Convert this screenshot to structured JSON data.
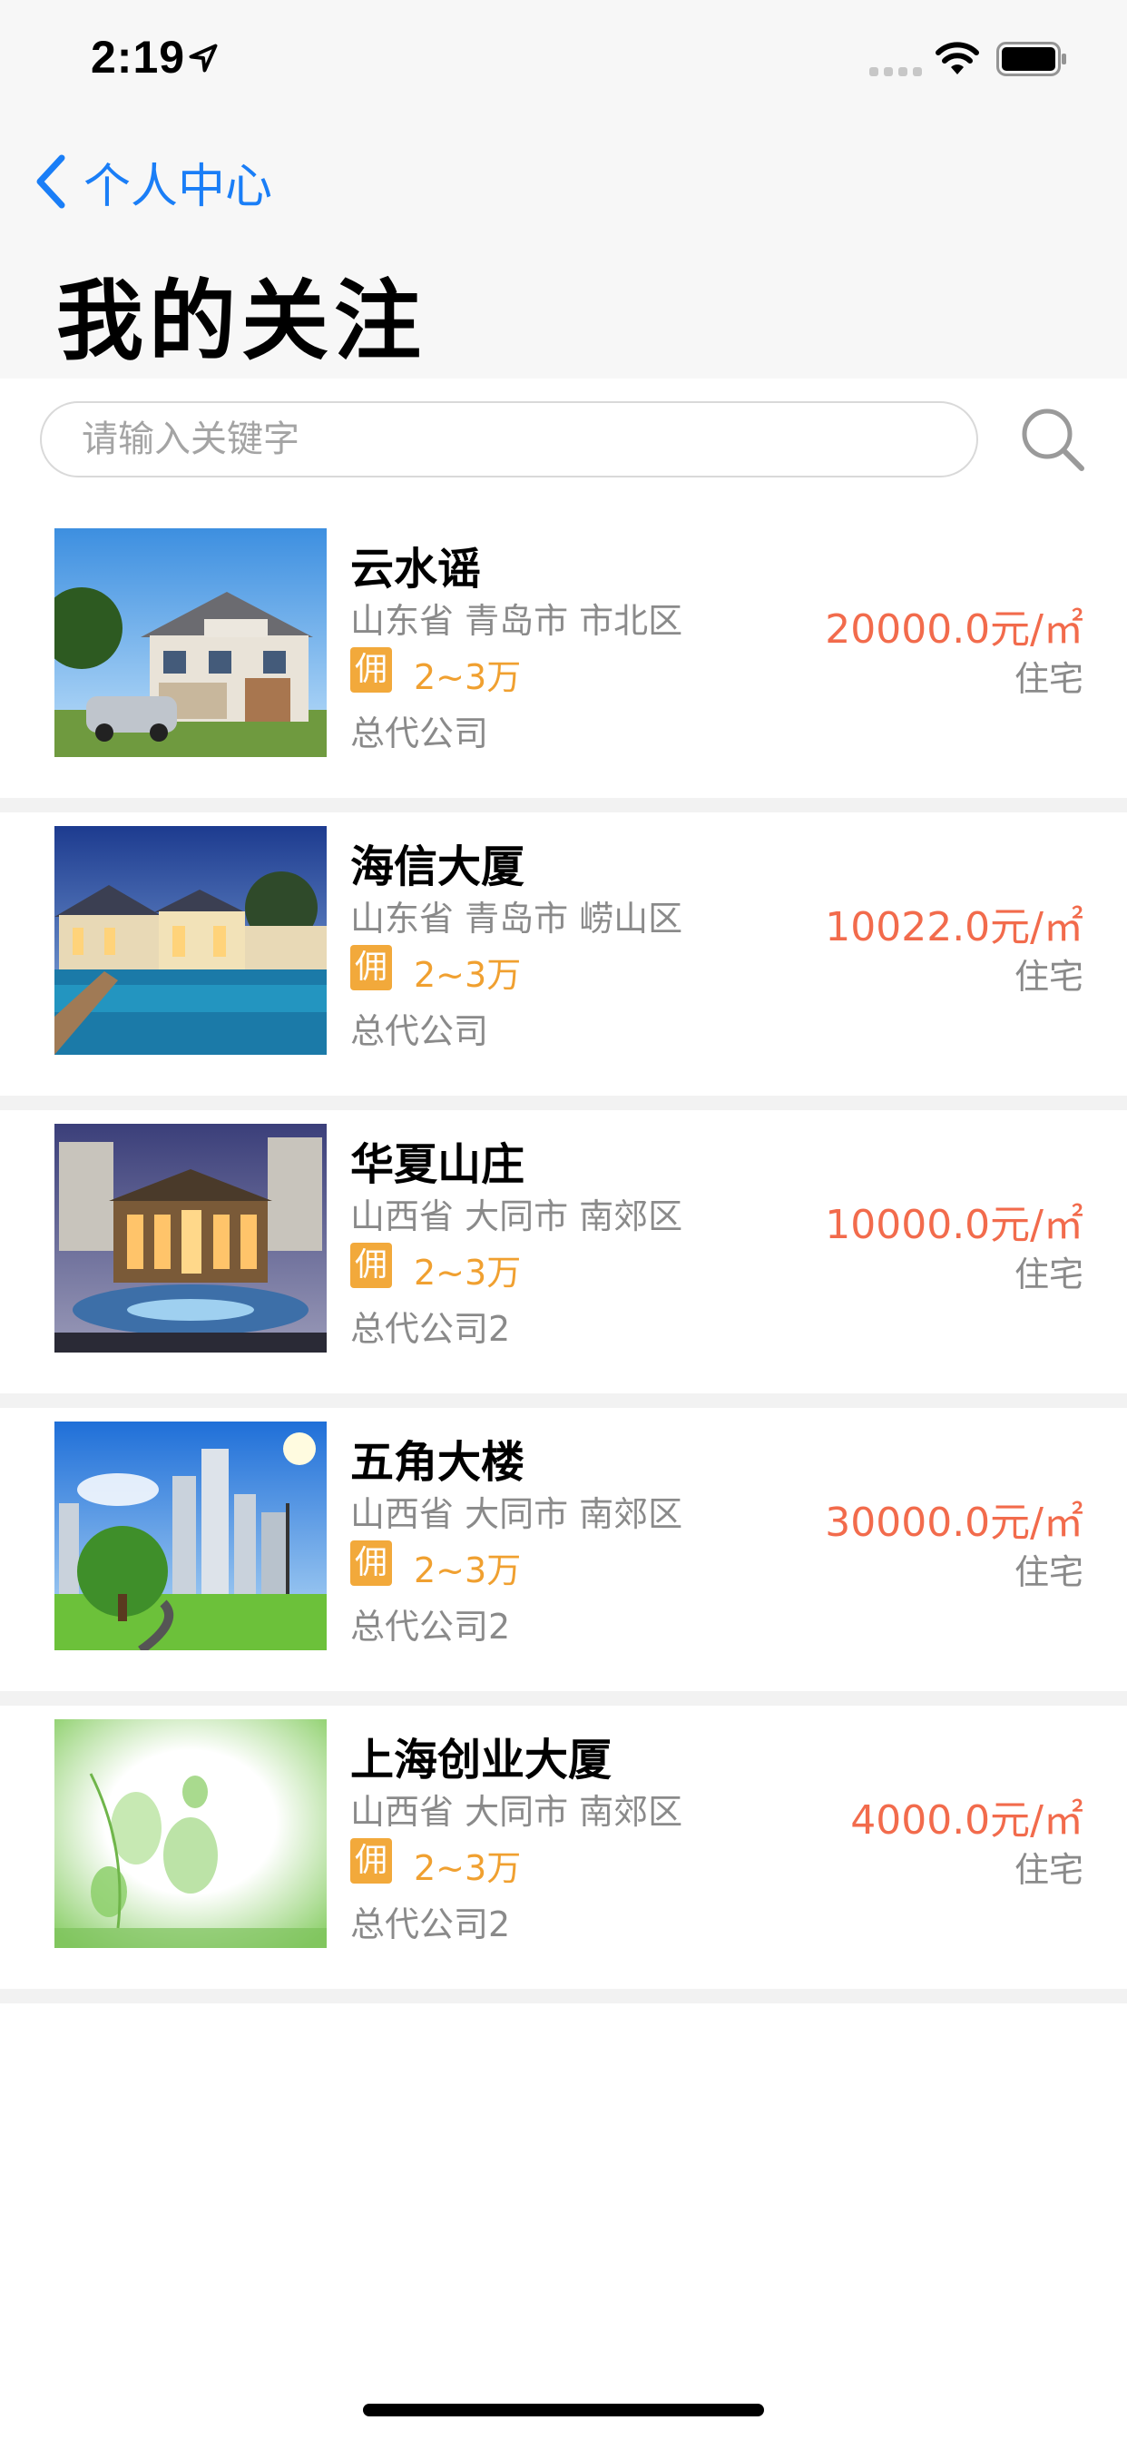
{
  "status_bar": {
    "time": "2:19"
  },
  "nav": {
    "back_label": "个人中心",
    "title": "我的关注"
  },
  "search": {
    "placeholder": "请输入关键字",
    "value": ""
  },
  "colors": {
    "accent": "#1a7ef7",
    "price": "#f26b4c",
    "commission": "#f0a030",
    "badge": "#f2a93b"
  },
  "listings": [
    {
      "name": "云水谣",
      "address": "山东省 青岛市 市北区",
      "badge": "佣",
      "commission": "2~3万",
      "agent": "总代公司",
      "price": "20000.0元/㎡",
      "type": "住宅",
      "image": "suburban-house-photo"
    },
    {
      "name": "海信大厦",
      "address": "山东省 青岛市 崂山区",
      "badge": "佣",
      "commission": "2~3万",
      "agent": "总代公司",
      "price": "10022.0元/㎡",
      "type": "住宅",
      "image": "villa-pool-night-photo"
    },
    {
      "name": "华夏山庄",
      "address": "山西省 大同市 南郊区",
      "badge": "佣",
      "commission": "2~3万",
      "agent": "总代公司2",
      "price": "10000.0元/㎡",
      "type": "住宅",
      "image": "clubhouse-fountain-night-photo"
    },
    {
      "name": "五角大楼",
      "address": "山西省 大同市 南郊区",
      "badge": "佣",
      "commission": "2~3万",
      "agent": "总代公司2",
      "price": "30000.0元/㎡",
      "type": "住宅",
      "image": "city-towers-park-photo"
    },
    {
      "name": "上海创业大厦",
      "address": "山西省 大同市 南郊区",
      "badge": "佣",
      "commission": "2~3万",
      "agent": "总代公司2",
      "price": "4000.0元/㎡",
      "type": "住宅",
      "image": "green-leaves-frame-photo"
    }
  ]
}
